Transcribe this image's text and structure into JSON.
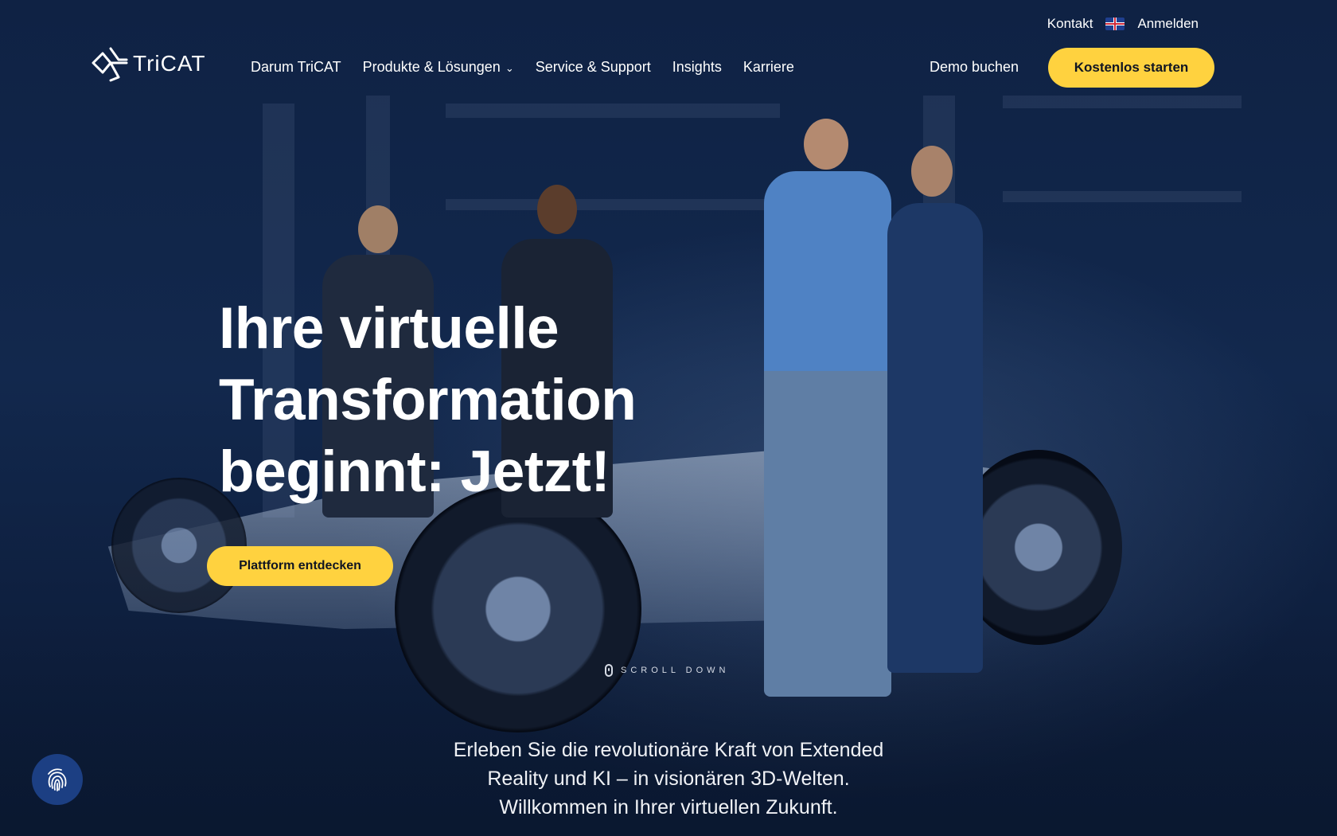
{
  "header": {
    "logo_text": "TriCAT",
    "utility_nav": {
      "contact": "Kontakt",
      "language_flag": "uk-flag-icon",
      "login": "Anmelden"
    },
    "main_nav": [
      {
        "label": "Darum TriCAT"
      },
      {
        "label": "Produkte & Lösungen",
        "has_dropdown": true
      },
      {
        "label": "Service & Support"
      },
      {
        "label": "Insights"
      },
      {
        "label": "Karriere"
      }
    ],
    "demo_link": "Demo buchen",
    "cta": "Kostenlos starten"
  },
  "hero": {
    "title_lines": [
      "Ihre virtuelle",
      "Transformation",
      "beginnt: Jetzt!"
    ],
    "cta": "Plattform entdecken",
    "scroll_hint": "SCROLL DOWN",
    "intro": "Erleben Sie die revolutionäre Kraft von Extended Reality und KI – in visionären 3D-Welten. Willkommen in Ihrer virtuellen Zukunft."
  },
  "widgets": {
    "privacy_button_icon": "fingerprint-icon"
  },
  "colors": {
    "background": "#0d1d3a",
    "accent": "#ffd23f",
    "widget": "#1c3f83"
  }
}
